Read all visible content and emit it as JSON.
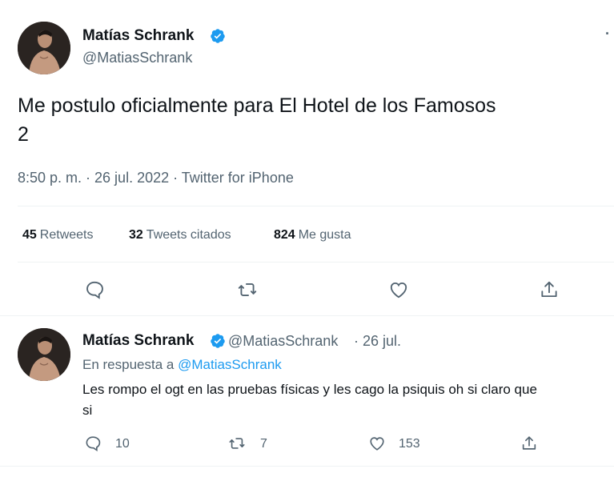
{
  "main_tweet": {
    "author_name": "Matías Schrank",
    "author_handle": "@MatiasSchrank",
    "more_label": "·",
    "text": "Me postulo oficialmente para El Hotel de los Famosos 2",
    "text_line1": "Me postulo oficialmente para El Hotel de los Famosos",
    "text_line2": "2",
    "timestamp": "8:50 p. m. · 26 jul. 2022 · Twitter for iPhone",
    "stats": {
      "retweets_count": "45",
      "retweets_label": "Retweets",
      "quotes_count": "32",
      "quotes_label": "Tweets citados",
      "likes_count": "824",
      "likes_label": "Me gusta"
    },
    "actions": [
      "reply-icon",
      "retweet-icon",
      "like-icon",
      "share-icon"
    ]
  },
  "reply_tweet": {
    "author_name": "Matías Schrank",
    "author_handle": "@MatiasSchrank",
    "date": "· 26 jul.",
    "reply_prefix": "En respuesta a",
    "reply_to_handle": "@MatiasSchrank",
    "text_line1": "Les rompo el ogt en las pruebas físicas y les cago la psiquis oh si claro que",
    "text_line2": "si",
    "counts": {
      "replies": "10",
      "retweets": "7",
      "likes": "153"
    }
  },
  "colors": {
    "accent": "#1d9bf0",
    "text": "#0f1419",
    "secondary": "#536471",
    "divider": "#eff3f4"
  }
}
